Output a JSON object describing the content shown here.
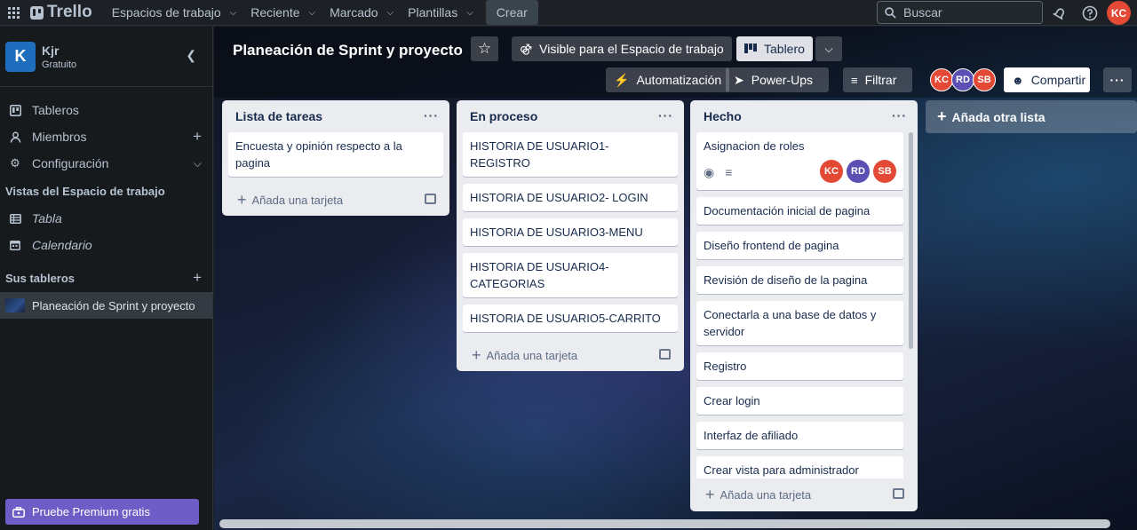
{
  "nav": {
    "logo": "Trello",
    "menus": [
      "Espacios de trabajo",
      "Reciente",
      "Marcado",
      "Plantillas"
    ],
    "create": "Crear",
    "search_placeholder": "Buscar",
    "user_initials": "KC"
  },
  "sidebar": {
    "workspace_initial": "K",
    "workspace_name": "Kjr",
    "workspace_plan": "Gratuito",
    "items": [
      "Tableros",
      "Miembros",
      "Configuración"
    ],
    "views_header": "Vistas del Espacio de trabajo",
    "views": [
      "Tabla",
      "Calendario"
    ],
    "boards_header": "Sus tableros",
    "boards": [
      "Planeación de Sprint y proyecto"
    ],
    "premium": "Pruebe Premium gratis"
  },
  "board": {
    "title": "Planeación de Sprint y proyecto",
    "visibility": "Visible para el Espacio de trabajo",
    "view": "Tablero",
    "automation": "Automatización",
    "powerups": "Power-Ups",
    "filter": "Filtrar",
    "share": "Compartir",
    "members": [
      {
        "initials": "KC",
        "color": "#e34935"
      },
      {
        "initials": "RD",
        "color": "#5b4fb4"
      },
      {
        "initials": "SB",
        "color": "#e34935"
      }
    ],
    "add_list": "Añada otra lista",
    "add_card": "Añada una tarjeta"
  },
  "lists": [
    {
      "title": "Lista de tareas",
      "cards": [
        "Encuesta y opinión respecto a la pagina"
      ]
    },
    {
      "title": "En proceso",
      "cards": [
        "HISTORIA DE USUARIO1- REGISTRO",
        "HISTORIA DE USUARIO2- LOGIN",
        "HISTORIA DE USUARIO3-MENU",
        "HISTORIA DE USUARIO4-CATEGORIAS",
        "HISTORIA DE USUARIO5-CARRITO"
      ]
    },
    {
      "title": "Hecho",
      "cards": [
        "Asignacion de roles",
        "Documentación inicial de pagina",
        "Diseño frontend de pagina",
        "Revisión de diseño de la pagina",
        "Conectarla a una base de datos y servidor",
        "Registro",
        "Crear login",
        "Interfaz de afiliado",
        "Crear vista para administrador"
      ]
    }
  ],
  "colors": {
    "accent": "#1f6ebd",
    "premium": "#6e5dc6",
    "avatar_red": "#e34935",
    "avatar_purple": "#5b4fb4"
  }
}
